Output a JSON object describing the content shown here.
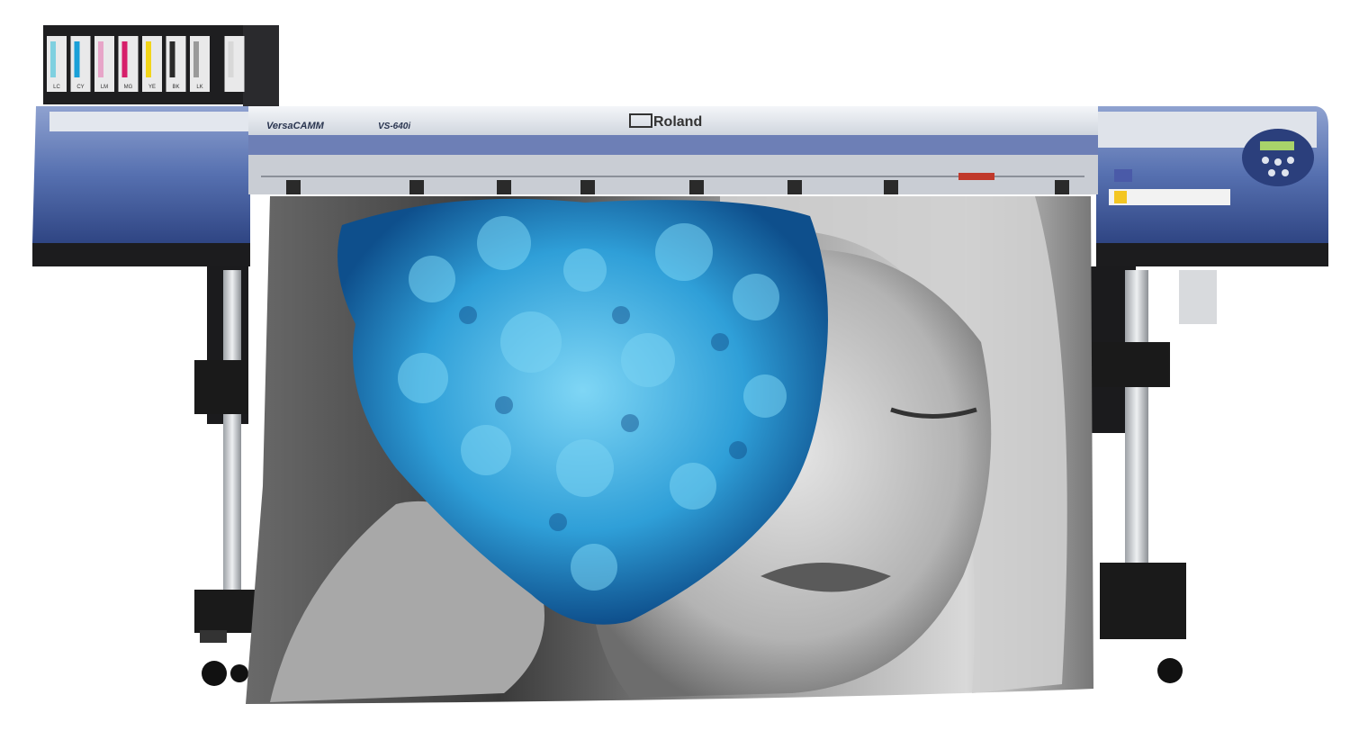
{
  "product": {
    "brand": "Roland",
    "series": "VersaCAMM",
    "model": "VS-640i"
  },
  "ink_cartridges": [
    {
      "label": "LC",
      "color": "#7fd0e0"
    },
    {
      "label": "CY",
      "color": "#1aa0d8"
    },
    {
      "label": "LM",
      "color": "#e7a5c8"
    },
    {
      "label": "MG",
      "color": "#d61f6a"
    },
    {
      "label": "YE",
      "color": "#f2d51a"
    },
    {
      "label": "BK",
      "color": "#2a2a2a"
    },
    {
      "label": "LK",
      "color": "#9a9a9a"
    },
    {
      "label": "",
      "color": "#d8d8d8"
    }
  ],
  "colors": {
    "body_blue": "#5a74b3",
    "body_light": "#e6e9ef",
    "frame_dark": "#1d1d1f",
    "leg_silver": "#c9ccd0",
    "flower_blue": "#2f9fd8"
  }
}
